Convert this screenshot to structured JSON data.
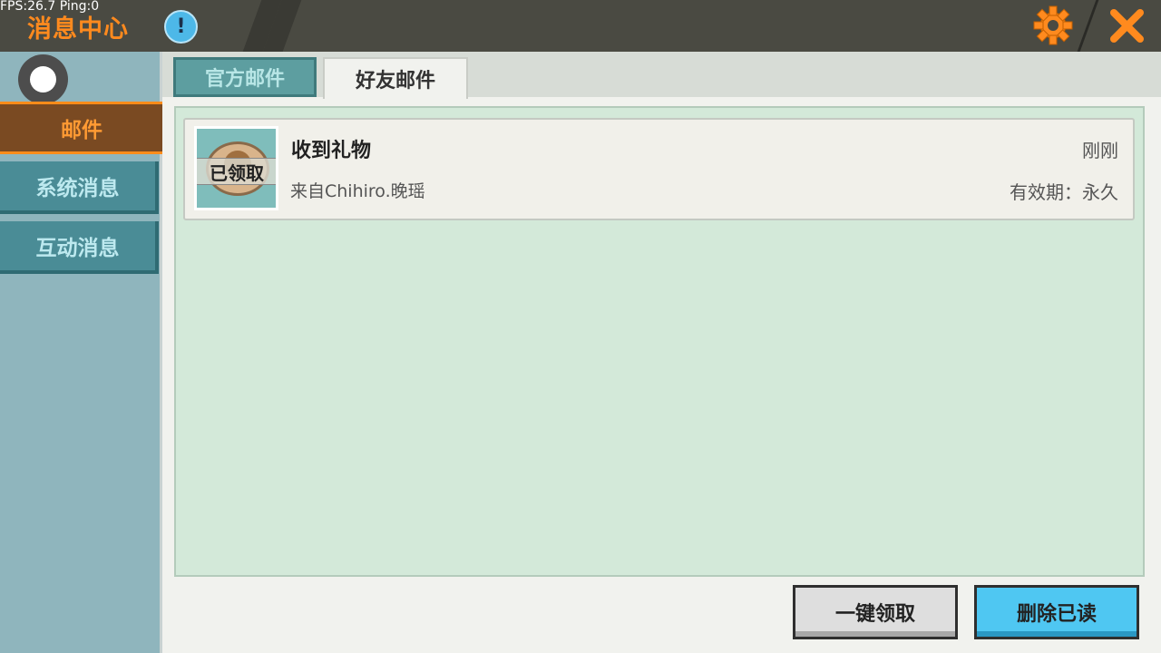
{
  "overlay": {
    "fps_text": "FPS:26.7  Ping:0"
  },
  "header": {
    "title": "消息中心",
    "info_icon": "exclamation-icon",
    "settings_icon": "gear-icon",
    "close_icon": "close-icon",
    "colors": {
      "title": "#ff8a1e",
      "bar": "#4a4a42",
      "accent": "#ff8a1e"
    }
  },
  "sidebar": {
    "items": [
      {
        "label": "邮件",
        "active": true
      },
      {
        "label": "系统消息",
        "active": false
      },
      {
        "label": "互动消息",
        "active": false
      }
    ]
  },
  "tabs": [
    {
      "label": "官方邮件",
      "active": false
    },
    {
      "label": "好友邮件",
      "active": true
    }
  ],
  "mails": [
    {
      "title": "收到礼物",
      "from": "来自Chihiro.晚瑶",
      "time": "刚刚",
      "expiry": "有效期：永久",
      "status": "已领取"
    }
  ],
  "actions": {
    "claim_all": "一键领取",
    "delete_read": "删除已读"
  }
}
